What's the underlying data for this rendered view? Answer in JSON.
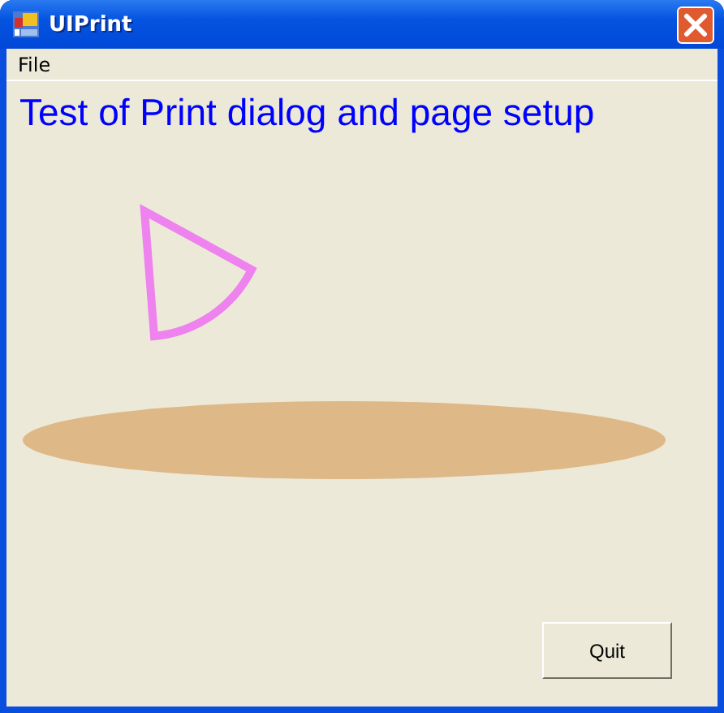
{
  "window": {
    "title": "UIPrint"
  },
  "menu": [
    {
      "label": "File"
    }
  ],
  "heading": "Test of Print dialog and page setup",
  "buttons": [
    {
      "label": "Quit"
    }
  ]
}
